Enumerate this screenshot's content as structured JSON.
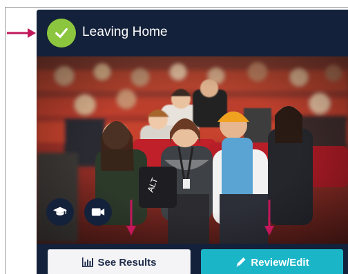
{
  "card": {
    "title": "Leaving Home",
    "status_icon": "check-icon",
    "status_color": "#8cc63f",
    "background_color": "#14213a"
  },
  "photo": {
    "description_icon_left": "graduation-cap-icon",
    "description_icon_right": "video-camera-icon"
  },
  "footer": {
    "see_results_label": "See Results",
    "see_results_icon": "bar-chart-icon",
    "review_edit_label": "Review/Edit",
    "review_edit_icon": "pencil-icon",
    "accent_color": "#1bb5c8"
  },
  "annotations": {
    "arrow_color": "#c2185b"
  }
}
